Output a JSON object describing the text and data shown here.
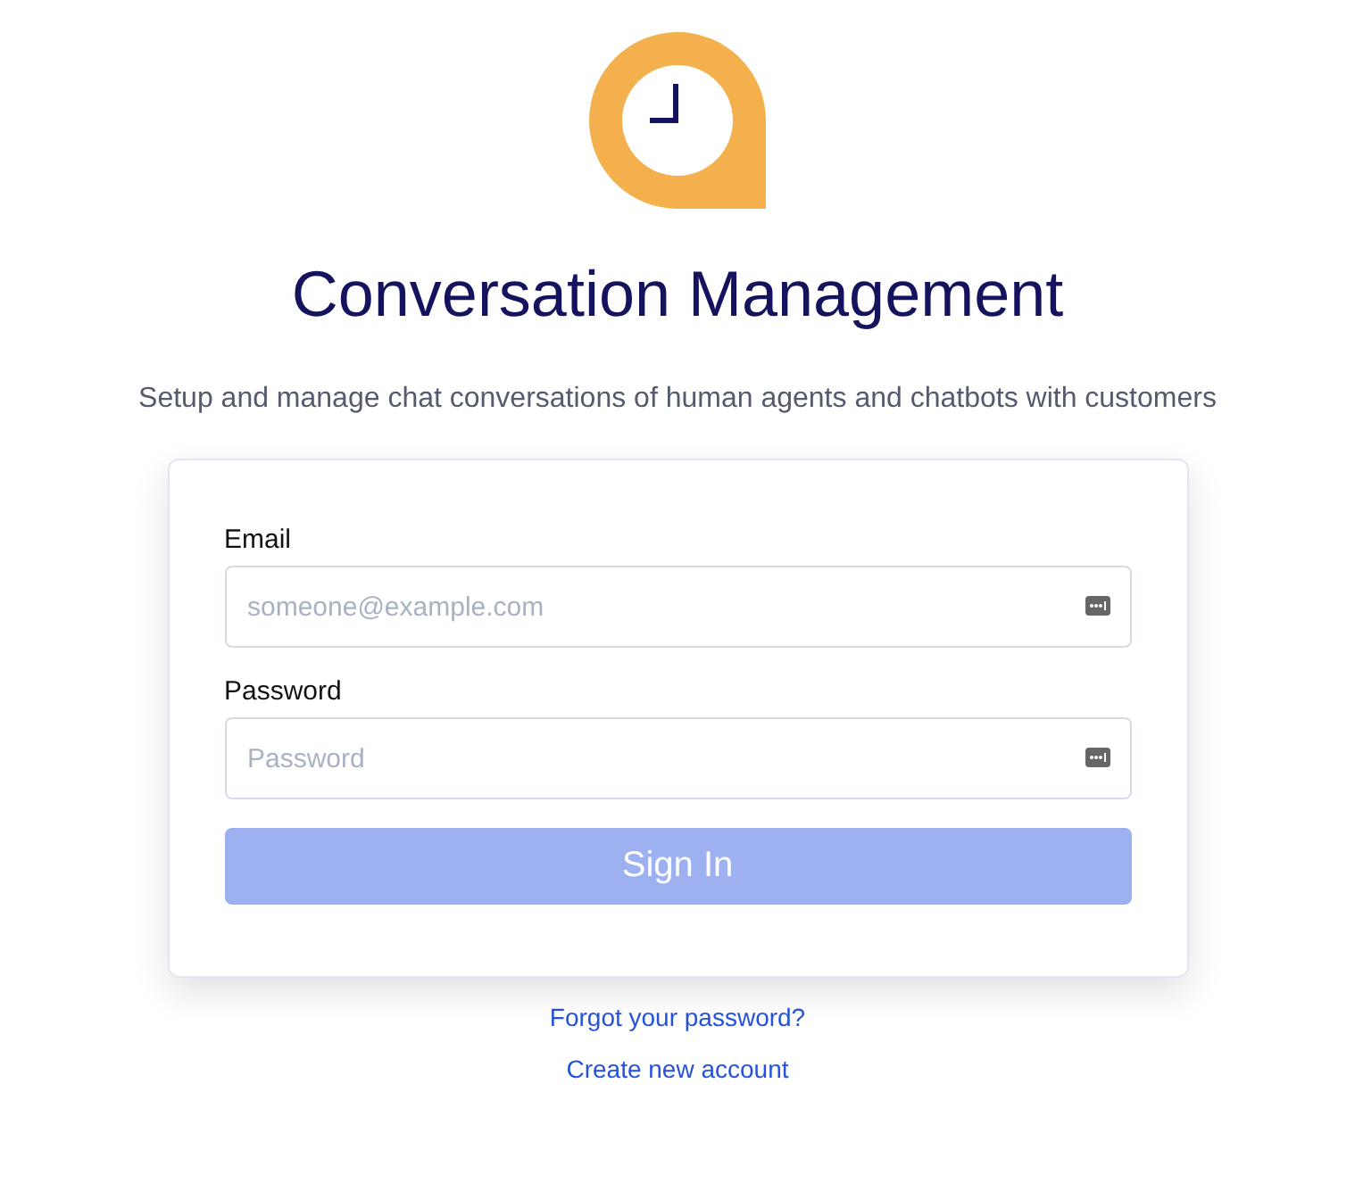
{
  "title": "Conversation Management",
  "subtitle": "Setup and manage chat conversations of human agents and chatbots with customers",
  "form": {
    "fields": [
      {
        "label": "Email",
        "placeholder": "someone@example.com"
      },
      {
        "label": "Password",
        "placeholder": "Password"
      }
    ],
    "submit": {
      "label": "Sign In",
      "disabled": true
    }
  },
  "links": [
    "Forgot your password?",
    "Create new account"
  ]
}
